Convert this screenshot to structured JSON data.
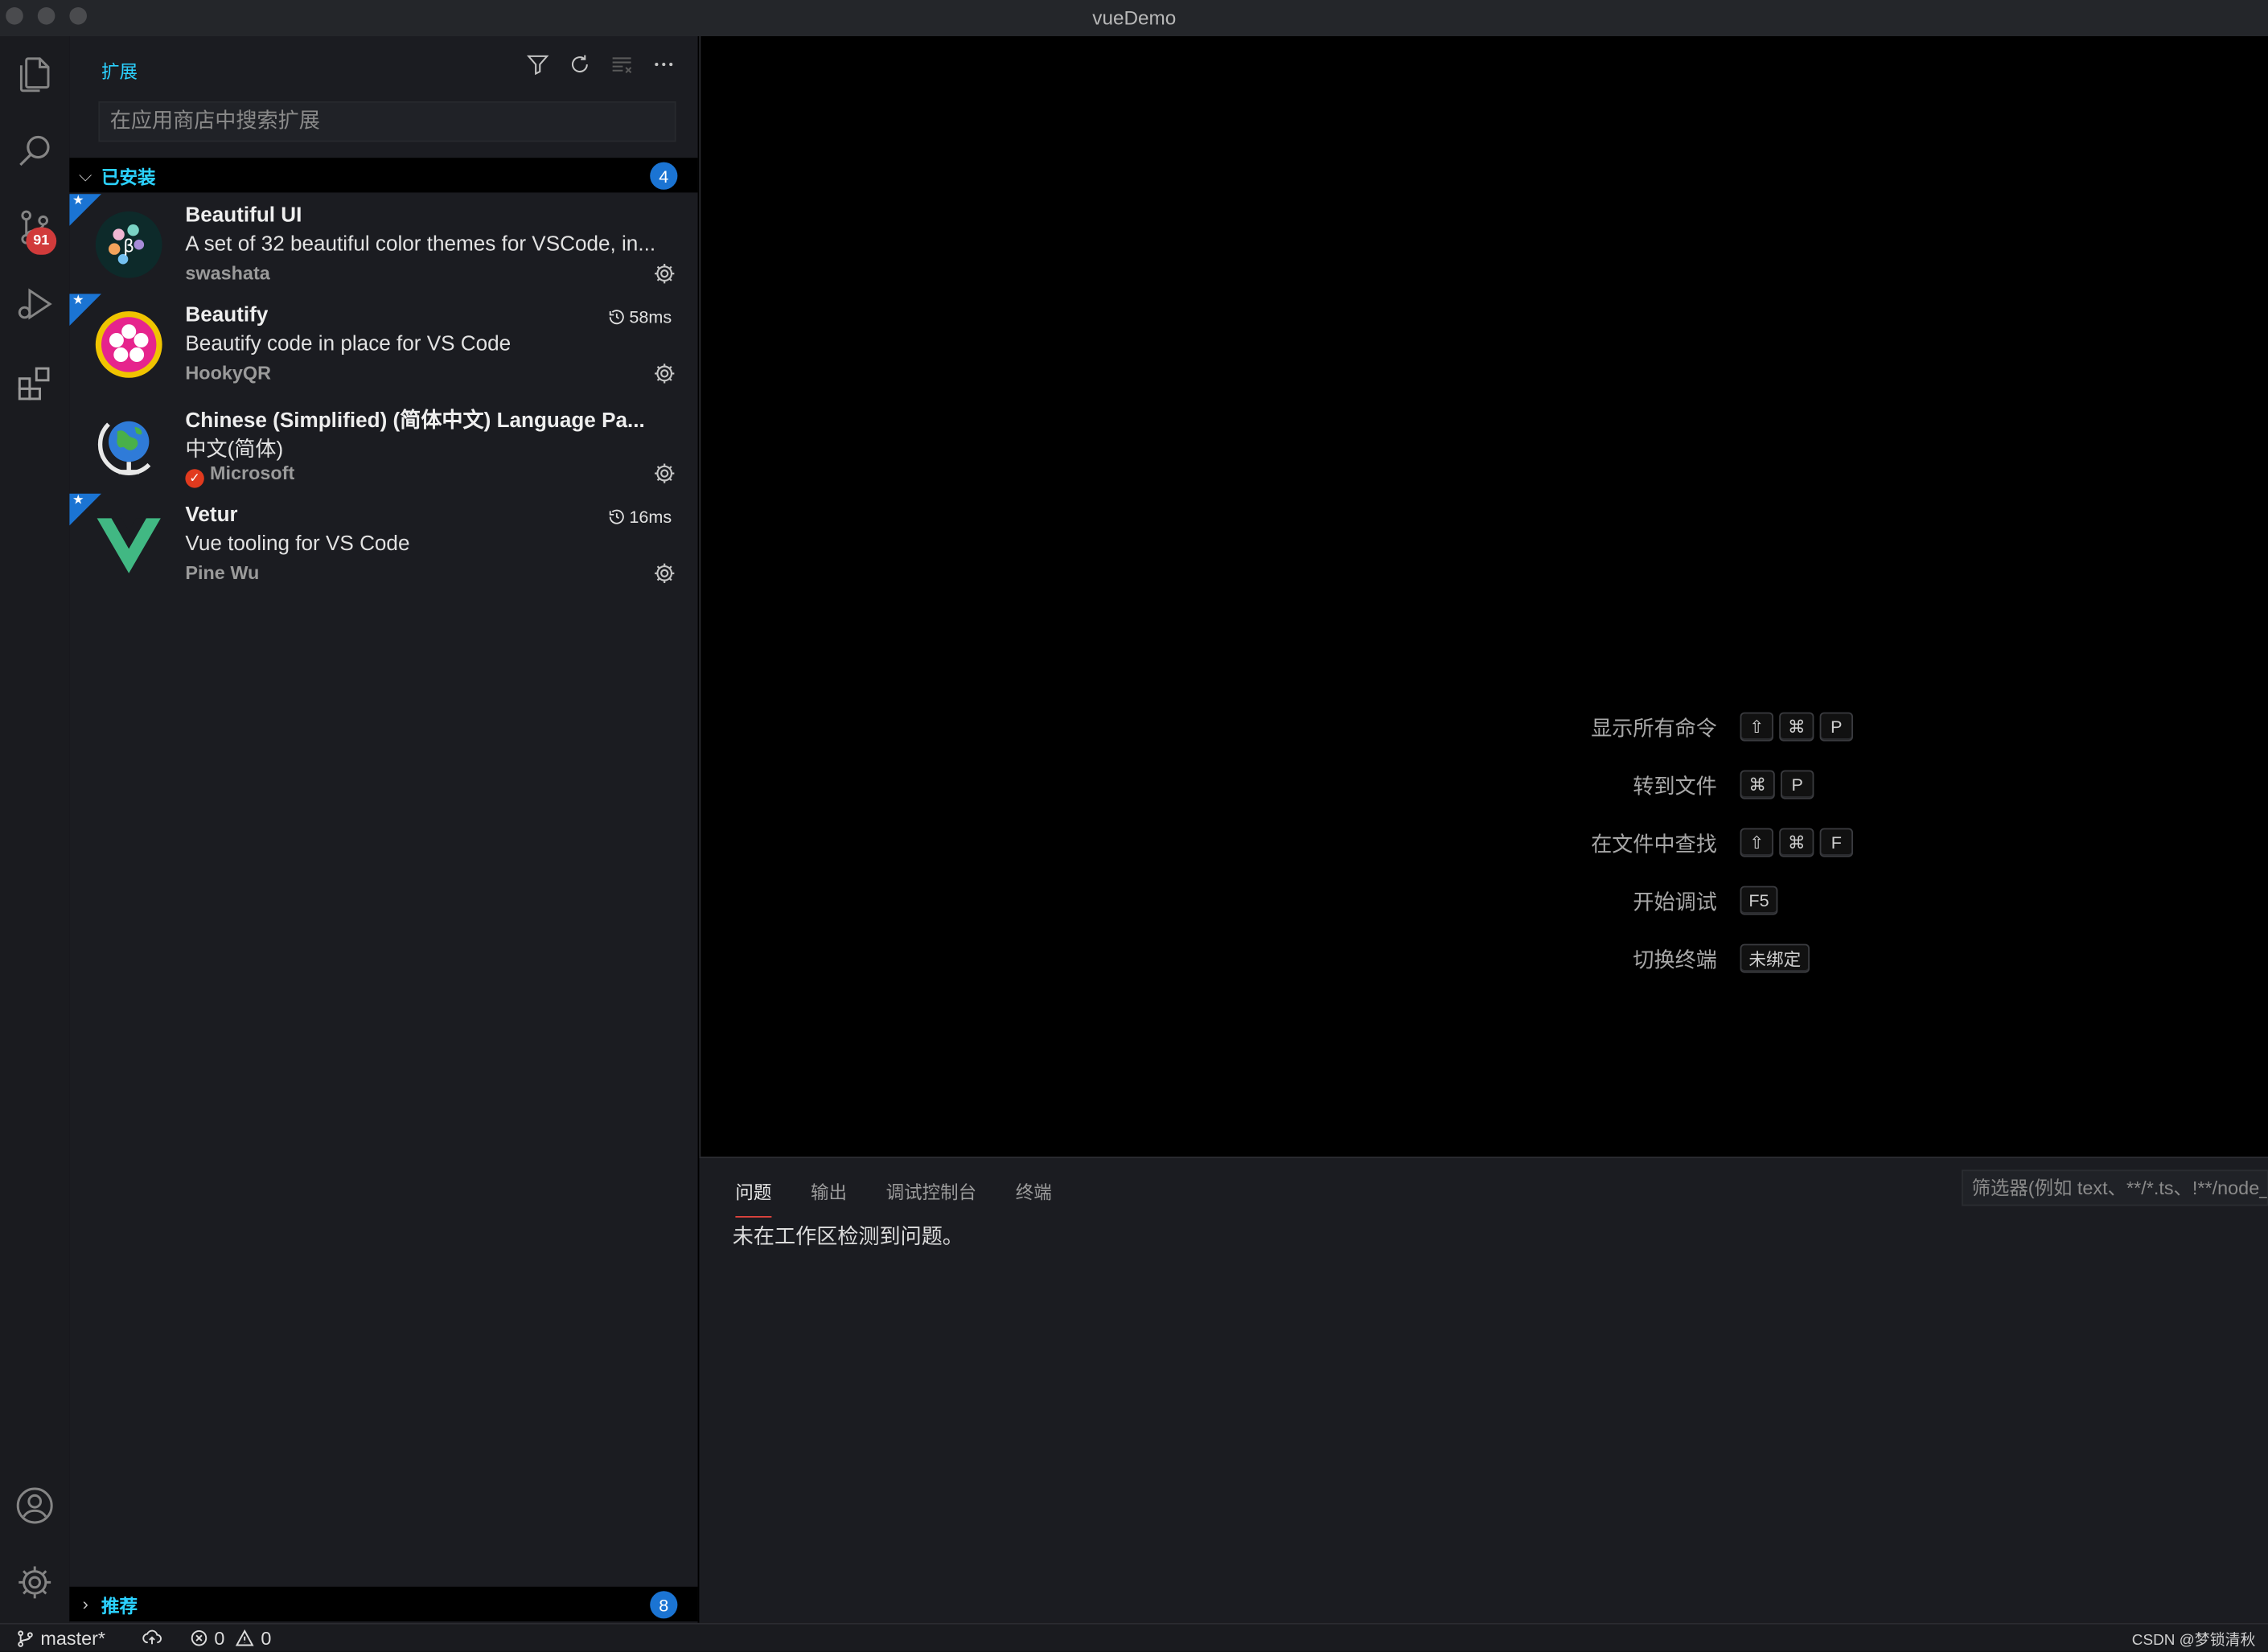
{
  "window": {
    "title": "vueDemo"
  },
  "activity": {
    "scm_badge": "91"
  },
  "sidebar": {
    "title": "扩展",
    "search_placeholder": "在应用商店中搜索扩展",
    "installed": {
      "label": "已安装",
      "count": "4"
    },
    "recommended": {
      "label": "推荐",
      "count": "8"
    },
    "extensions": [
      {
        "name": "Beautiful UI",
        "description": "A set of 32 beautiful color themes for VSCode, in...",
        "publisher": "swashata",
        "time": "",
        "starred": true,
        "verified": false
      },
      {
        "name": "Beautify",
        "description": "Beautify code in place for VS Code",
        "publisher": "HookyQR",
        "time": "58ms",
        "starred": true,
        "verified": false
      },
      {
        "name": "Chinese (Simplified) (简体中文) Language Pa...",
        "description": "中文(简体)",
        "publisher": "Microsoft",
        "time": "",
        "starred": false,
        "verified": true
      },
      {
        "name": "Vetur",
        "description": "Vue tooling for VS Code",
        "publisher": "Pine Wu",
        "time": "16ms",
        "starred": true,
        "verified": false
      }
    ]
  },
  "editor": {
    "shortcuts": [
      {
        "label": "显示所有命令",
        "keys": [
          "⇧",
          "⌘",
          "P"
        ]
      },
      {
        "label": "转到文件",
        "keys": [
          "⌘",
          "P"
        ]
      },
      {
        "label": "在文件中查找",
        "keys": [
          "⇧",
          "⌘",
          "F"
        ]
      },
      {
        "label": "开始调试",
        "keys": [
          "F5"
        ]
      },
      {
        "label": "切换终端",
        "keys": [
          "未绑定"
        ]
      }
    ]
  },
  "panel": {
    "tabs": [
      "问题",
      "输出",
      "调试控制台",
      "终端"
    ],
    "active_tab": "问题",
    "filter_placeholder": "筛选器(例如 text、**/*.ts、!**/node_modules/**)",
    "message": "未在工作区检测到问题。"
  },
  "statusbar": {
    "branch": "master*",
    "errors": "0",
    "warnings": "0",
    "watermark": "CSDN @梦锁清秋"
  },
  "colors": {
    "accent": "#2bd1ff",
    "badge_blue": "#1b74d3",
    "badge_red": "#d13b3b",
    "active_tab_line": "#e0443e"
  }
}
